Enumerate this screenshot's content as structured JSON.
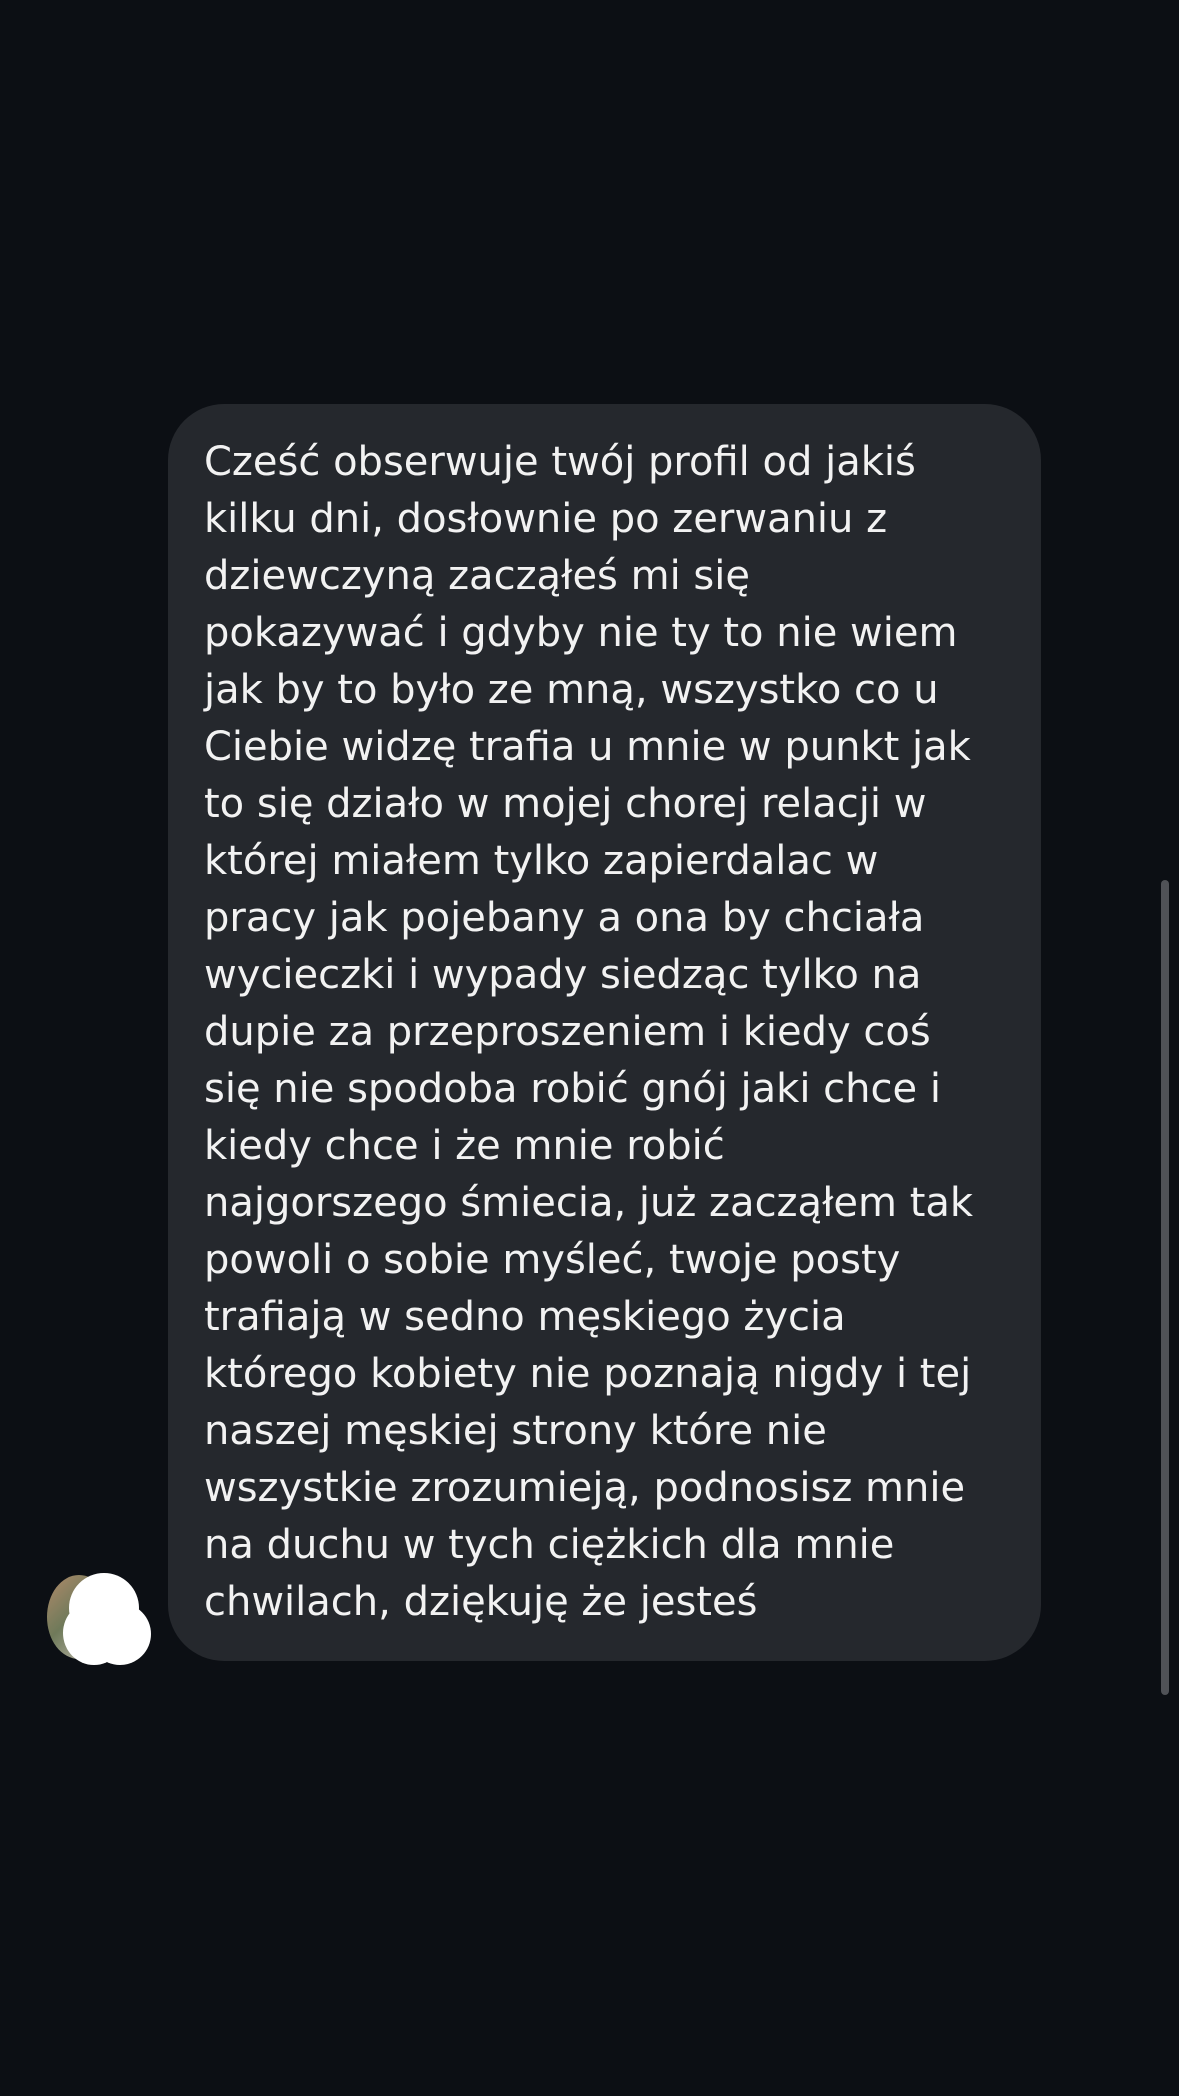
{
  "thread": {
    "messages": [
      {
        "direction": "incoming",
        "text": "Cześć obserwuje twój profil od jakiś\nkilku dni, dosłownie po zerwaniu z\ndziewczyną zacząłeś mi się\npokazywać i gdyby nie ty to nie wiem\njak by to było ze mną, wszystko co u\nCiebie widzę trafia u mnie w punkt jak\nto się działo w mojej chorej relacji w\nktórej miałem tylko zapierdalac w\npracy jak pojebany a ona by chciała\nwycieczki i wypady siedząc tylko na\ndupie za przeproszeniem i kiedy coś\nsię nie spodoba robić gnój jaki chce i\nkiedy chce i że mnie robić\nnajgorszego śmiecia, już zacząłem tak\npowoli o sobie myśleć, twoje posty\ntrafiają w sedno męskiego życia\nktórego kobiety nie poznają nigdy i tej\nnaszej męskiej strony które nie\nwszystkie zrozumieją, podnosisz mnie\nna duchu w tych ciężkich dla mnie\nchwilach, dziękuję że jesteś"
      }
    ]
  },
  "colors": {
    "background": "#0c0f14",
    "bubble": "#25282d",
    "text": "#f2f2f2",
    "scrollbar": "#505257"
  }
}
